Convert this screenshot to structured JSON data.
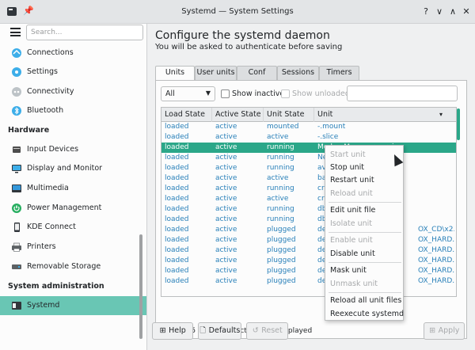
{
  "window": {
    "title": "Systemd — System Settings",
    "buttons": [
      "?",
      "∨",
      "∧",
      "✕"
    ]
  },
  "sidebar": {
    "search_placeholder": "Search...",
    "items_top": [
      {
        "label": "Connections",
        "icon": "connections-icon",
        "color": "#3daee9"
      },
      {
        "label": "Settings",
        "icon": "network-settings-icon",
        "color": "#3daee9"
      },
      {
        "label": "Connectivity",
        "icon": "connectivity-icon",
        "color": "#7f8c8d"
      },
      {
        "label": "Bluetooth",
        "icon": "bluetooth-icon",
        "color": "#3daee9"
      }
    ],
    "hardware_header": "Hardware",
    "hardware_items": [
      {
        "label": "Input Devices",
        "icon": "input-devices-icon"
      },
      {
        "label": "Display and Monitor",
        "icon": "display-icon"
      },
      {
        "label": "Multimedia",
        "icon": "multimedia-icon"
      },
      {
        "label": "Power Management",
        "icon": "power-icon"
      },
      {
        "label": "KDE Connect",
        "icon": "kde-connect-icon"
      },
      {
        "label": "Printers",
        "icon": "printer-icon"
      },
      {
        "label": "Removable Storage",
        "icon": "removable-storage-icon"
      }
    ],
    "sysadmin_header": "System administration",
    "active_item": {
      "label": "Systemd",
      "icon": "systemd-icon"
    }
  },
  "main": {
    "heading": "Configure the systemd daemon",
    "subheading": "You will be asked to authenticate before saving",
    "tabs": [
      "Units",
      "User units",
      "Conf",
      "Sessions",
      "Timers"
    ],
    "active_tab": "Units",
    "filter": {
      "selected": "All",
      "show_inactive": "Show inactive",
      "show_unloaded": "Show unloaded"
    },
    "columns": [
      "Load State",
      "Active State",
      "Unit State",
      "Unit"
    ],
    "rows": [
      [
        "loaded",
        "active",
        "mounted",
        "-.mount"
      ],
      [
        "loaded",
        "active",
        "active",
        "-.slice"
      ],
      [
        "loaded",
        "active",
        "running",
        "ModemManager.service"
      ],
      [
        "loaded",
        "active",
        "running",
        "Ne"
      ],
      [
        "loaded",
        "active",
        "running",
        "ava"
      ],
      [
        "loaded",
        "active",
        "active",
        "ba"
      ],
      [
        "loaded",
        "active",
        "running",
        "cro"
      ],
      [
        "loaded",
        "active",
        "active",
        "cry"
      ],
      [
        "loaded",
        "active",
        "running",
        "dbu"
      ],
      [
        "loaded",
        "active",
        "running",
        "dbu"
      ],
      [
        "loaded",
        "active",
        "plugged",
        "dev"
      ],
      [
        "loaded",
        "active",
        "plugged",
        "dev"
      ],
      [
        "loaded",
        "active",
        "plugged",
        "dev"
      ],
      [
        "loaded",
        "active",
        "plugged",
        "dev"
      ],
      [
        "loaded",
        "active",
        "plugged",
        "dev"
      ],
      [
        "loaded",
        "active",
        "plugged",
        "dev"
      ]
    ],
    "row_tails": [
      "",
      "",
      "",
      "",
      "",
      "",
      "",
      "",
      "",
      "",
      "OX_CD\\x2...",
      "OX_HARD...",
      "OX_HARD...",
      "OX_HARD...",
      "OX_HARD...",
      "OX_HARD..."
    ],
    "selected_row": 2,
    "totals": "Total: 365 units, 124 active, 124 displayed"
  },
  "context_menu": {
    "items": [
      {
        "label": "Start unit",
        "enabled": false
      },
      {
        "label": "Stop unit",
        "enabled": true
      },
      {
        "label": "Restart unit",
        "enabled": true
      },
      {
        "label": "Reload unit",
        "enabled": false
      },
      {
        "label": "Edit unit file",
        "enabled": true
      },
      {
        "label": "Isolate unit",
        "enabled": false
      },
      {
        "label": "Enable unit",
        "enabled": false
      },
      {
        "label": "Disable unit",
        "enabled": true
      },
      {
        "label": "Mask unit",
        "enabled": true
      },
      {
        "label": "Unmask unit",
        "enabled": false
      },
      {
        "label": "Reload all unit files",
        "enabled": true
      },
      {
        "label": "Reexecute systemd",
        "enabled": true
      }
    ]
  },
  "buttons": {
    "help": "Help",
    "defaults": "Defaults",
    "reset": "Reset",
    "apply": "Apply"
  },
  "colors": {
    "accent": "#2ba789",
    "sidebar_active": "#69c6b4",
    "link": "#2980b9"
  }
}
